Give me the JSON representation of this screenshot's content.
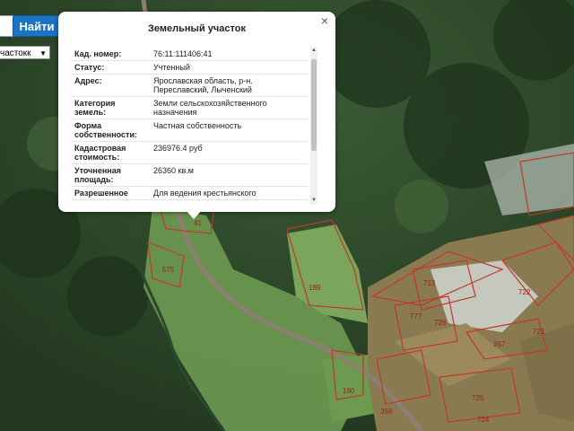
{
  "search": {
    "button_label": "Найти"
  },
  "type_select": {
    "selected": "частокк"
  },
  "popup": {
    "title": "Земельный участок",
    "close_glyph": "×",
    "rows": [
      {
        "label": "Кад. номер:",
        "value": "76:11:111406:41"
      },
      {
        "label": "Статус:",
        "value": "Учтенный"
      },
      {
        "label": "Адрес:",
        "value": "Ярославская область, р-н. Переславский, Лыченский"
      },
      {
        "label": "Категория земель:",
        "value": "Земли сельскохозяйственного назначения"
      },
      {
        "label": "Форма собственности:",
        "value": "Частная собственность"
      },
      {
        "label": "Кадастровая стоимость:",
        "value": "236976.4 руб"
      },
      {
        "label": "Уточненная площадь:",
        "value": "26360 кв.м"
      },
      {
        "label": "Разрешенное",
        "value": "Для ведения крестьянского"
      }
    ]
  },
  "map": {
    "parcel_labels": [
      "41",
      "575",
      "189",
      "713",
      "722",
      "777",
      "726",
      "721",
      "357",
      "190",
      "725",
      "358",
      "724"
    ]
  },
  "colors": {
    "button": "#1b73c4",
    "parcel_border": "#c0392b"
  }
}
